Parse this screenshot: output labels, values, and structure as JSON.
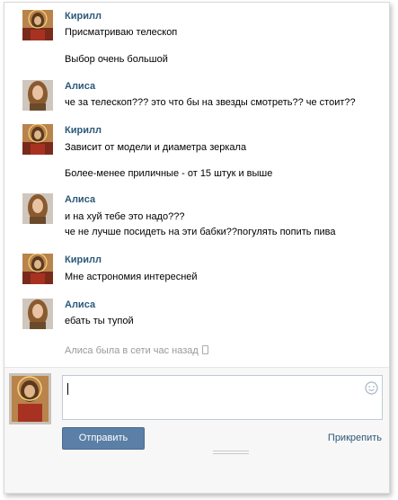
{
  "messages": [
    {
      "author": "Кирилл",
      "avatar": "jesus-avatar",
      "lines": [
        "Присматриваю телескоп",
        "Выбор очень большой"
      ]
    },
    {
      "author": "Алиса",
      "avatar": "girl-avatar",
      "lines": [
        "че за телескоп??? это что бы на звезды смотреть?? че стоит??"
      ]
    },
    {
      "author": "Кирилл",
      "avatar": "jesus-avatar",
      "lines": [
        "Зависит от модели и диаметра зеркала",
        "Более-менее приличные - от 15 штук и выше"
      ]
    },
    {
      "author": "Алиса",
      "avatar": "girl-avatar",
      "lines": [
        "и на хуй тебе это надо???",
        "че не лучше посидеть на эти бабки??погулять попить пива"
      ]
    },
    {
      "author": "Кирилл",
      "avatar": "jesus-avatar",
      "lines": [
        "Мне астрономия интересней"
      ]
    },
    {
      "author": "Алиса",
      "avatar": "girl-avatar",
      "lines": [
        "ебать ты тупой"
      ]
    }
  ],
  "status": {
    "text": "Алиса была в сети час назад",
    "icon": "mobile-icon"
  },
  "composer": {
    "send_label": "Отправить",
    "attach_label": "Прикрепить",
    "emoji_icon": "smile-icon"
  },
  "colors": {
    "author": "#2b587a",
    "send_button": "#5b7fa6",
    "status": "#999999"
  }
}
